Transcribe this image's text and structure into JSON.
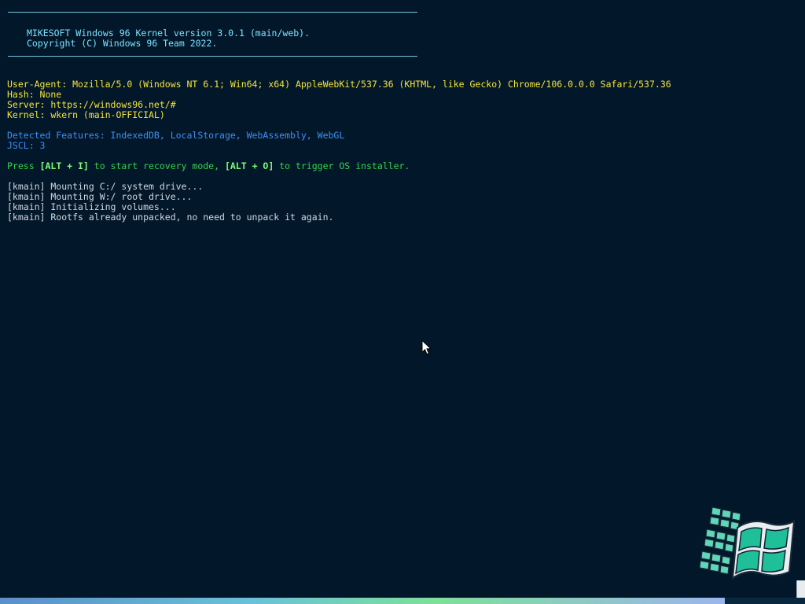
{
  "banner": {
    "line1": "MIKESOFT Windows 96 Kernel version 3.0.1 (main/web).",
    "line2": "Copyright (C) Windows 96 Team 2022."
  },
  "info": {
    "user_agent": "User-Agent: Mozilla/5.0 (Windows NT 6.1; Win64; x64) AppleWebKit/537.36 (KHTML, like Gecko) Chrome/106.0.0.0 Safari/537.36",
    "hash": "Hash: None",
    "server": "Server: https://windows96.net/#",
    "kernel": "Kernel: wkern (main-OFFICIAL)"
  },
  "features": {
    "detected": "Detected Features: IndexedDB, LocalStorage, WebAssembly, WebGL",
    "jscl": "JSCL: 3"
  },
  "hint": {
    "press": "Press ",
    "key1": "[ALT + I]",
    "middle": " to start recovery mode, ",
    "key2": "[ALT + O]",
    "end": " to trigger OS installer."
  },
  "log": [
    "[kmain] Mounting C:/ system drive...",
    "[kmain] Mounting W:/ root drive...",
    "[kmain] Initializing volumes...",
    "[kmain] Rootfs already unpacked, no need to unpack it again."
  ],
  "boot_progress": 0.9,
  "icons": {
    "cursor": "mouse-pointer-icon",
    "logo": "windows-96-logo-icon"
  },
  "colors": {
    "background": "#03172a",
    "banner": "#7ae3ff",
    "info": "#f2e43a",
    "features": "#3f8ff2",
    "hint": "#35d24d",
    "log": "#cfd8df"
  }
}
